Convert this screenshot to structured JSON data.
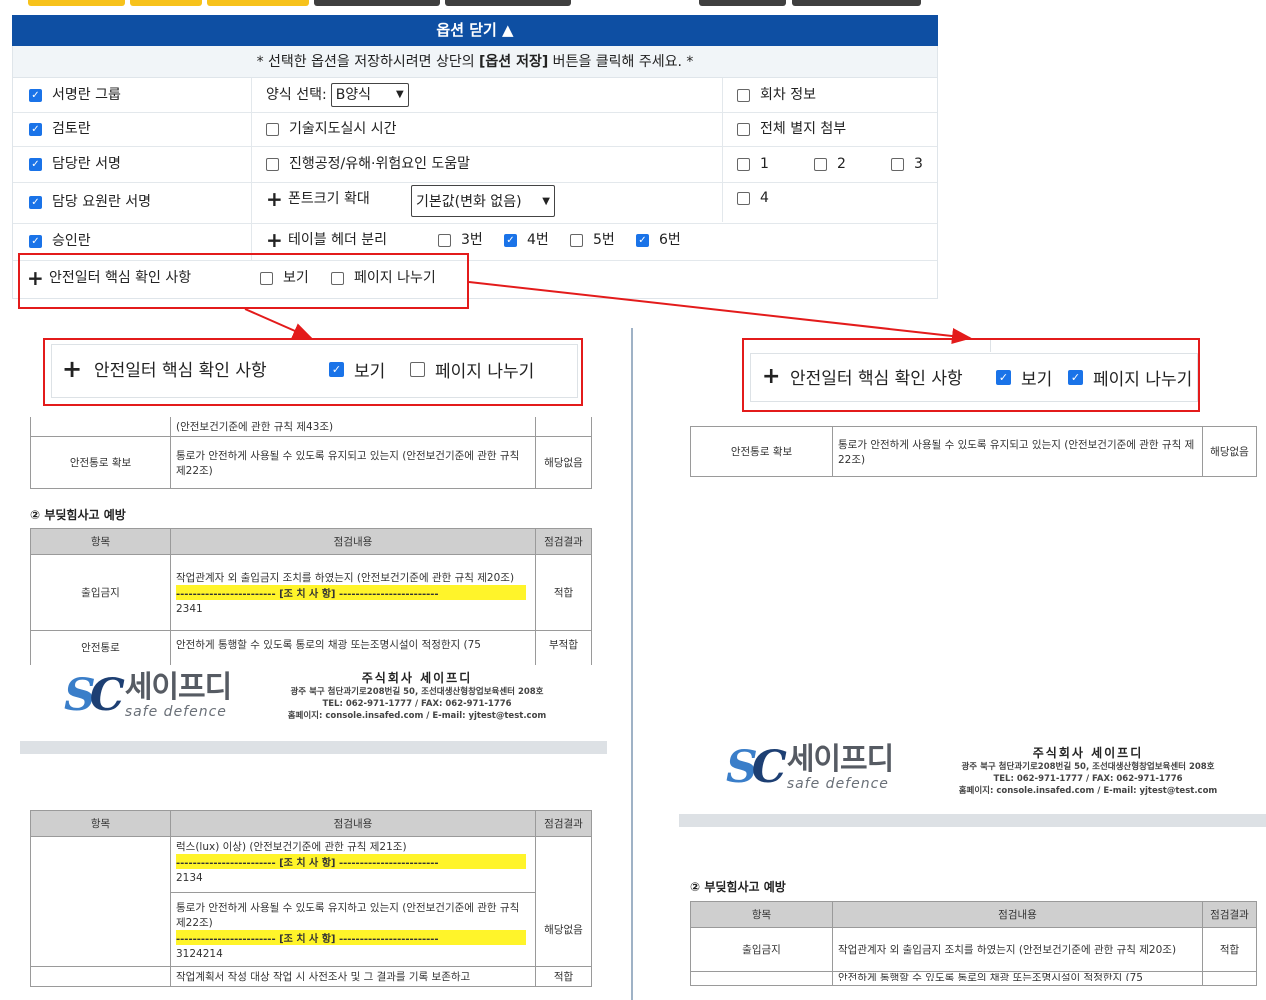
{
  "options_panel": {
    "toggle_label": "옵션 닫기 ▲",
    "notice_prefix": "* 선택한 옵션을 저장하시려면 상단의 ",
    "notice_bold": "[옵션 저장]",
    "notice_suffix": " 버튼을 클릭해 주세요. *",
    "col1": [
      {
        "label": "서명란 그룹",
        "checked": true
      },
      {
        "label": "검토란",
        "checked": true
      },
      {
        "label": "담당란 서명",
        "checked": true
      },
      {
        "label": "담당 요원란 서명",
        "checked": true
      },
      {
        "label": "승인란",
        "checked": true
      }
    ],
    "form_select_label": "양식 선택:",
    "form_select_value": "B양식",
    "tech_guidance_label": "기술지도실시 시간",
    "process_help_label": "진행공정/유해·위험요인 도움말",
    "font_size_label": "폰트크기 확대",
    "font_size_value": "기본값(변화 없음)",
    "table_header_label": "테이블 헤더 분리",
    "table_header_options": [
      {
        "label": "3번",
        "checked": false
      },
      {
        "label": "4번",
        "checked": true
      },
      {
        "label": "5번",
        "checked": false
      },
      {
        "label": "6번",
        "checked": true
      }
    ],
    "round_info_label": "회차 정보",
    "attach_all_label": "전체 별지 첨부",
    "attach_options": [
      {
        "label": "1",
        "checked": false
      },
      {
        "label": "2",
        "checked": false
      },
      {
        "label": "3",
        "checked": false
      },
      {
        "label": "4",
        "checked": false
      }
    ],
    "safety_row": {
      "label": "안전일터 핵심 확인 사항",
      "view_label": "보기",
      "view_checked": false,
      "page_break_label": "페이지 나누기",
      "page_break_checked": false
    }
  },
  "zoom_left": {
    "label": "안전일터 핵심 확인 사항",
    "view_label": "보기",
    "view_checked": true,
    "page_break_label": "페이지 나누기",
    "page_break_checked": false
  },
  "zoom_right": {
    "label": "안전일터 핵심 확인 사항",
    "view_label": "보기",
    "view_checked": true,
    "page_break_label": "페이지 나누기",
    "page_break_checked": true
  },
  "doc_left": {
    "top_fragment_left": "",
    "top_fragment_mid": "(안전보건기준에 관한 규칙 제43조)",
    "passage_item": "안전통로 확보",
    "passage_content": "통로가 안전하게 사용될 수 있도록 유지되고 있는지 (안전보건기준에 관한 규칙 제22조)",
    "passage_result": "해당없음",
    "section2_title": "② 부딪힘사고 예방",
    "headers": [
      "항목",
      "점검내용",
      "점검결과"
    ],
    "access_item": "출입금지",
    "access_content": "작업관계자 외 출입금지 조치를 하였는지 (안전보건기준에 관한 규칙 제20조)",
    "action_banner": "------------------------ [조 치 사 항] ------------------------",
    "access_action_value": "2341",
    "access_result": "적합",
    "passage2_item": "안전통로",
    "passage2_content": "안전하게 통행할 수 있도록 통로의 채광 또는조명시설이 적정한지 (75",
    "passage2_result": "부적합",
    "page2_row1_content": "럭스(lux) 이상) (안전보건기준에 관한 규칙 제21조)",
    "page2_row1_action": "2134",
    "page2_row2_content": "통로가 안전하게 사용될 수 있도록 유지하고 있는지 (안전보건기준에 관한 규칙 제22조)",
    "page2_row2_action": "3124214",
    "page2_row2_result": "해당없음",
    "page2_row3_content": "작업계획서 작성 대상 작업 시 사전조사 및 그 결과를 기록 보존하고",
    "page2_row3_result": "적합"
  },
  "doc_right": {
    "passage_item": "안전통로 확보",
    "passage_content": "통로가 안전하게 사용될 수 있도록 유지되고 있는지 (안전보건기준에 관한 규칙 제22조)",
    "passage_result": "해당없음",
    "section2_title": "② 부딪힘사고 예방",
    "headers": [
      "항목",
      "점검내용",
      "점검결과"
    ],
    "access_item": "출입금지",
    "access_content": "작업관계자 외 출입금지 조치를 하였는지 (안전보건기준에 관한 규칙 제20조)",
    "access_result": "적합",
    "next_row_fragment": "안전하게 통행할 수 있도록 통로의 채광 또는조명시설이 적정한지 (75"
  },
  "company": {
    "logo_kr": "세이프디",
    "logo_en": "safe defence",
    "name": "주식회사 세이프디",
    "address": "광주 북구 첨단과기로208번길 50, 조선대생산형창업보육센터 208호",
    "tel_fax": "TEL: 062-971-1777 / FAX: 062-971-1776",
    "web_mail": "홈페이지: console.insafed.com / E-mail: yjtest@test.com"
  },
  "colors": {
    "header_blue": "#0e4fa3",
    "highlight_red": "#e31b1b",
    "check_blue": "#1a73e8",
    "action_yellow": "#fff42a"
  }
}
